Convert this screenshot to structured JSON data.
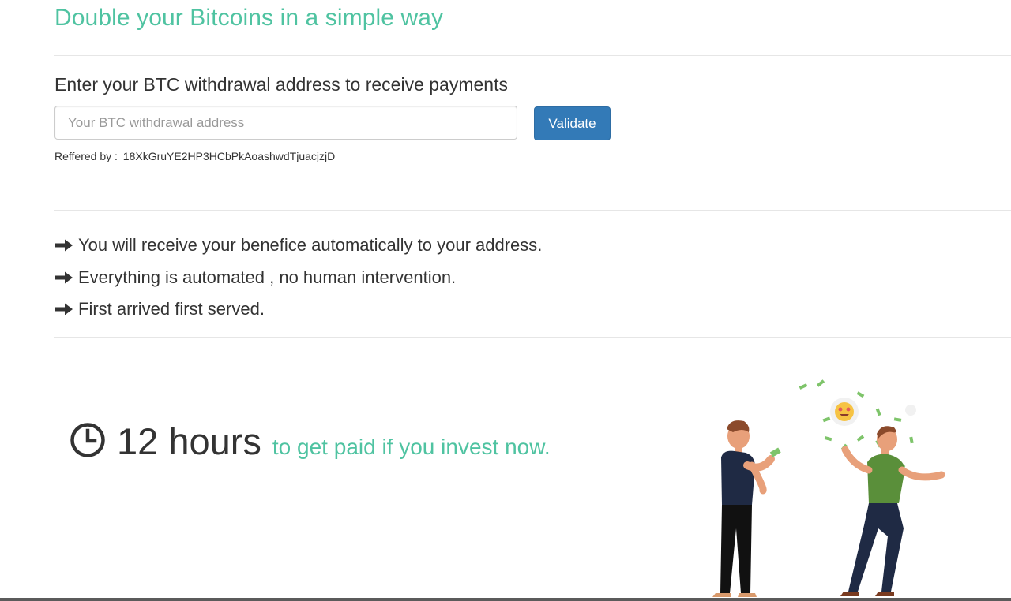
{
  "header": {
    "title": "Double your Bitcoins in a simple way"
  },
  "form": {
    "prompt": "Enter your BTC withdrawal address to receive payments",
    "address_placeholder": "Your BTC withdrawal address",
    "address_value": "",
    "validate_label": "Validate",
    "referred_label": "Reffered by :",
    "referred_address": "18XkGruYE2HP3HCbPkAoashwdTjuacjzjD"
  },
  "benefits": {
    "items": [
      {
        "icon": "arrow-right-icon",
        "text": "You will receive your benefice automatically to your address."
      },
      {
        "icon": "arrow-right-icon",
        "text": "Everything is automated , no human intervention."
      },
      {
        "icon": "arrow-right-icon",
        "text": "First arrived first served."
      }
    ]
  },
  "countdown": {
    "icon": "clock-icon",
    "hours": "12 hours",
    "message": "to get paid if you invest now."
  },
  "colors": {
    "accent": "#4fc3a1",
    "button": "#337ab7",
    "text": "#333333"
  }
}
